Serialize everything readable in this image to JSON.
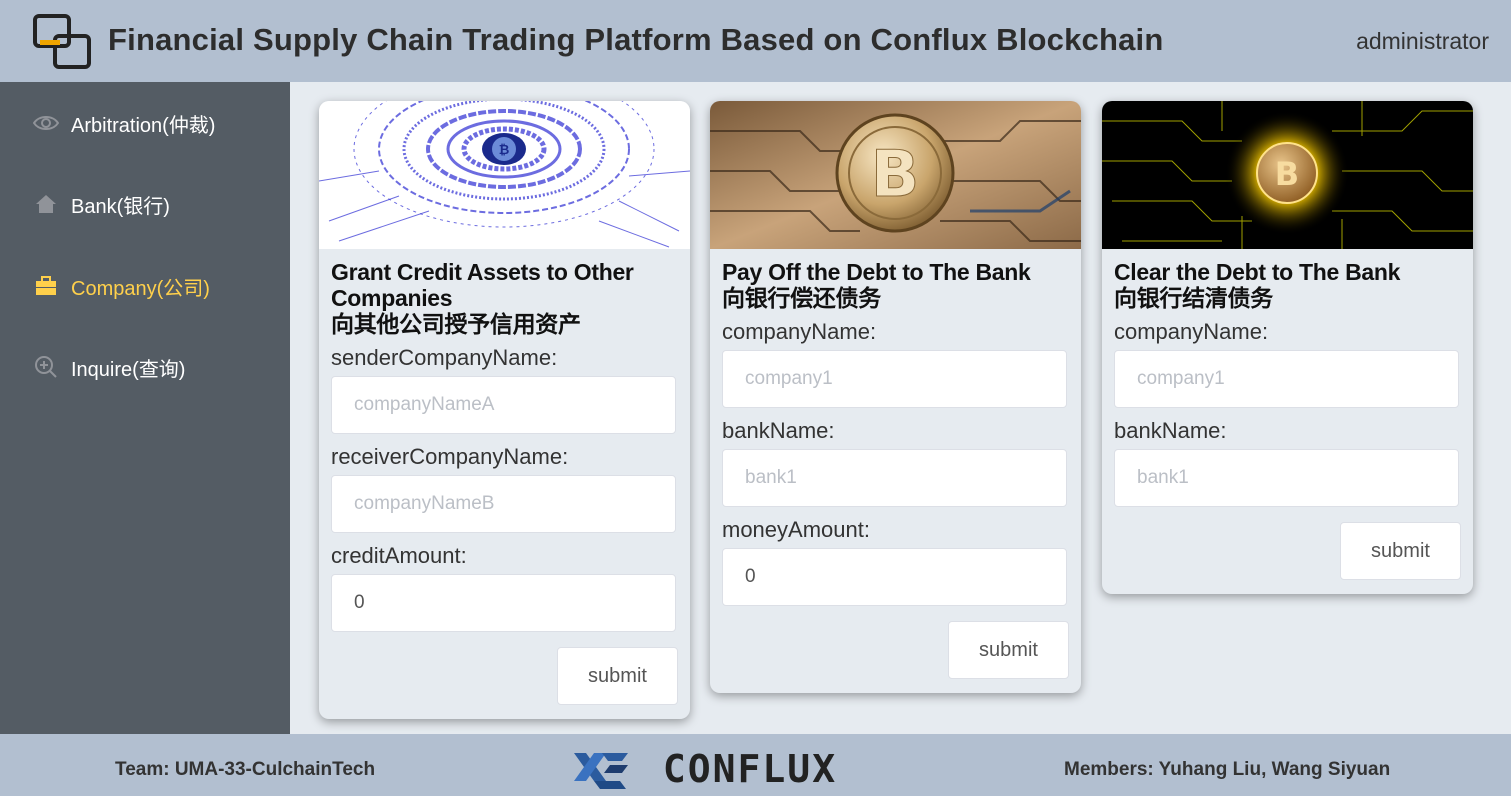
{
  "header": {
    "title": "Financial Supply Chain Trading Platform Based on Conflux Blockchain",
    "user": "administrator",
    "logo_icon": "overlapping-squares-logo-icon"
  },
  "sidebar": {
    "background": "#545c64",
    "active_color": "#ffd04b",
    "items": [
      {
        "label": "Arbitration(仲裁)",
        "icon": "eye-icon",
        "active": false
      },
      {
        "label": "Bank(银行)",
        "icon": "home-icon",
        "active": false
      },
      {
        "label": "Company(公司)",
        "icon": "briefcase-icon",
        "active": true
      },
      {
        "label": "Inquire(查询)",
        "icon": "zoom-in-icon",
        "active": false
      }
    ]
  },
  "cards": [
    {
      "title_en": "Grant Credit Assets to Other Companies",
      "title_cn": "向其他公司授予信用资产",
      "fields": [
        {
          "label": "senderCompanyName:",
          "placeholder": "companyNameA",
          "value": ""
        },
        {
          "label": "receiverCompanyName:",
          "placeholder": "companyNameB",
          "value": ""
        },
        {
          "label": "creditAmount:",
          "placeholder": "",
          "value": "0"
        }
      ],
      "submit": "submit"
    },
    {
      "title_en": "Pay Off the Debt to The Bank",
      "title_cn": "向银行偿还债务",
      "fields": [
        {
          "label": "companyName:",
          "placeholder": "company1",
          "value": ""
        },
        {
          "label": "bankName:",
          "placeholder": "bank1",
          "value": ""
        },
        {
          "label": "moneyAmount:",
          "placeholder": "",
          "value": "0"
        }
      ],
      "submit": "submit"
    },
    {
      "title_en": "Clear the Debt to The Bank",
      "title_cn": "向银行结清债务",
      "fields": [
        {
          "label": "companyName:",
          "placeholder": "company1",
          "value": ""
        },
        {
          "label": "bankName:",
          "placeholder": "bank1",
          "value": ""
        }
      ],
      "submit": "submit"
    }
  ],
  "footer": {
    "team": "Team: UMA-33-CulchainTech",
    "logo_text": "CONFLUX",
    "members": "Members: Yuhang Liu, Wang Siyuan"
  }
}
